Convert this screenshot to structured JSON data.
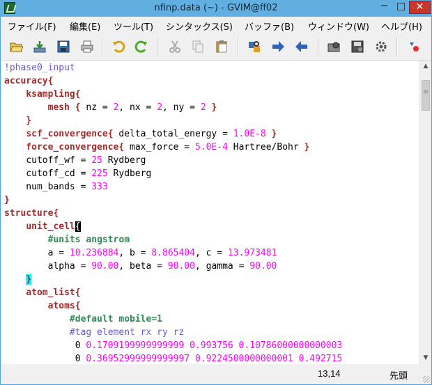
{
  "window": {
    "title": "nfinp.data (~) - GVIM@ff02",
    "controls": {
      "minimize": "─",
      "maximize": "□",
      "close": "✕"
    }
  },
  "menu": [
    "ファイル(F)",
    "編集(E)",
    "ツール(T)",
    "シンタックス(S)",
    "バッファ(B)",
    "ウィンドウ(W)",
    "ヘルプ(H)"
  ],
  "toolbar_icons": [
    "open-icon",
    "save-icon",
    "save-all-icon",
    "print-icon",
    "undo-icon",
    "redo-icon",
    "cut-icon",
    "copy-icon",
    "paste-icon",
    "find-replace-icon",
    "find-next-icon",
    "find-prev-icon",
    "load-session-icon",
    "save-session-icon",
    "run-script-icon",
    "tags-icon"
  ],
  "colors": {
    "keyword": "#a52a2a",
    "comment": "#2e8b57",
    "number": "#ff00ff",
    "special": "#6a5acd",
    "cursor_bg": "#000000",
    "match_paren_bg": "#00ffff",
    "title_bar": "#60afe0"
  },
  "editor": {
    "lines": [
      [
        {
          "t": "!phase0_input",
          "c": "special"
        }
      ],
      [
        {
          "t": "accuracy{",
          "c": "keyword"
        }
      ],
      [
        {
          "t": "    ",
          "c": ""
        },
        {
          "t": "ksampling{",
          "c": "keyword"
        }
      ],
      [
        {
          "t": "        ",
          "c": ""
        },
        {
          "t": "mesh",
          "c": "keyword"
        },
        {
          "t": " ",
          "c": ""
        },
        {
          "t": "{",
          "c": "keyword"
        },
        {
          "t": " nz = ",
          "c": ""
        },
        {
          "t": "2",
          "c": "number"
        },
        {
          "t": ", nx = ",
          "c": ""
        },
        {
          "t": "2",
          "c": "number"
        },
        {
          "t": ", ny = ",
          "c": ""
        },
        {
          "t": "2",
          "c": "number"
        },
        {
          "t": " ",
          "c": ""
        },
        {
          "t": "}",
          "c": "keyword"
        }
      ],
      [
        {
          "t": "    ",
          "c": ""
        },
        {
          "t": "}",
          "c": "keyword"
        }
      ],
      [
        {
          "t": "    ",
          "c": ""
        },
        {
          "t": "scf_convergence{",
          "c": "keyword"
        },
        {
          "t": " delta_total_energy = ",
          "c": ""
        },
        {
          "t": "1.0E-8",
          "c": "number"
        },
        {
          "t": " ",
          "c": ""
        },
        {
          "t": "}",
          "c": "keyword"
        }
      ],
      [
        {
          "t": "    ",
          "c": ""
        },
        {
          "t": "force_convergence{",
          "c": "keyword"
        },
        {
          "t": " max_force = ",
          "c": ""
        },
        {
          "t": "5.0E-4",
          "c": "number"
        },
        {
          "t": " Hartree/Bohr ",
          "c": ""
        },
        {
          "t": "}",
          "c": "keyword"
        }
      ],
      [
        {
          "t": "    cutoff_wf = ",
          "c": ""
        },
        {
          "t": "25",
          "c": "number"
        },
        {
          "t": " Rydberg",
          "c": ""
        }
      ],
      [
        {
          "t": "    cutoff_cd = ",
          "c": ""
        },
        {
          "t": "225",
          "c": "number"
        },
        {
          "t": " Rydberg",
          "c": ""
        }
      ],
      [
        {
          "t": "    num_bands = ",
          "c": ""
        },
        {
          "t": "333",
          "c": "number"
        }
      ],
      [
        {
          "t": "}",
          "c": "keyword"
        }
      ],
      [
        {
          "t": "structure{",
          "c": "keyword"
        }
      ],
      [
        {
          "t": "    ",
          "c": ""
        },
        {
          "t": "unit_cell",
          "c": "keyword"
        },
        {
          "t": "{",
          "c": "cursor"
        }
      ],
      [
        {
          "t": "        ",
          "c": ""
        },
        {
          "t": "#units angstrom",
          "c": "comment"
        }
      ],
      [
        {
          "t": "        a = ",
          "c": ""
        },
        {
          "t": "10.236884",
          "c": "number"
        },
        {
          "t": ", b = ",
          "c": ""
        },
        {
          "t": "8.865404",
          "c": "number"
        },
        {
          "t": ", c = ",
          "c": ""
        },
        {
          "t": "13.973481",
          "c": "number"
        }
      ],
      [
        {
          "t": "        alpha = ",
          "c": ""
        },
        {
          "t": "90.00",
          "c": "number"
        },
        {
          "t": ", beta = ",
          "c": ""
        },
        {
          "t": "90.00",
          "c": "number"
        },
        {
          "t": ", gamma = ",
          "c": ""
        },
        {
          "t": "90.00",
          "c": "number"
        }
      ],
      [
        {
          "t": "    ",
          "c": ""
        },
        {
          "t": "}",
          "c": "matchparen"
        }
      ],
      [
        {
          "t": "    ",
          "c": ""
        },
        {
          "t": "atom_list{",
          "c": "keyword"
        }
      ],
      [
        {
          "t": "        ",
          "c": ""
        },
        {
          "t": "atoms{",
          "c": "keyword"
        }
      ],
      [
        {
          "t": "            ",
          "c": ""
        },
        {
          "t": "#default mobile=1",
          "c": "comment"
        }
      ],
      [
        {
          "t": "            ",
          "c": ""
        },
        {
          "t": "#tag element rx ry rz",
          "c": "special"
        }
      ],
      [
        {
          "t": "             0 ",
          "c": ""
        },
        {
          "t": "0.1709199999999999 0.993756 0.10786000000000003",
          "c": "number"
        }
      ],
      [
        {
          "t": "             0 ",
          "c": ""
        },
        {
          "t": "0.36952999999999997 0.9224500000000001 0.492715",
          "c": "number"
        }
      ]
    ]
  },
  "scrollbar": {
    "up_arrow": "▲",
    "down_arrow": "▼"
  },
  "status": {
    "position": "13,14",
    "scroll": "先頭"
  }
}
